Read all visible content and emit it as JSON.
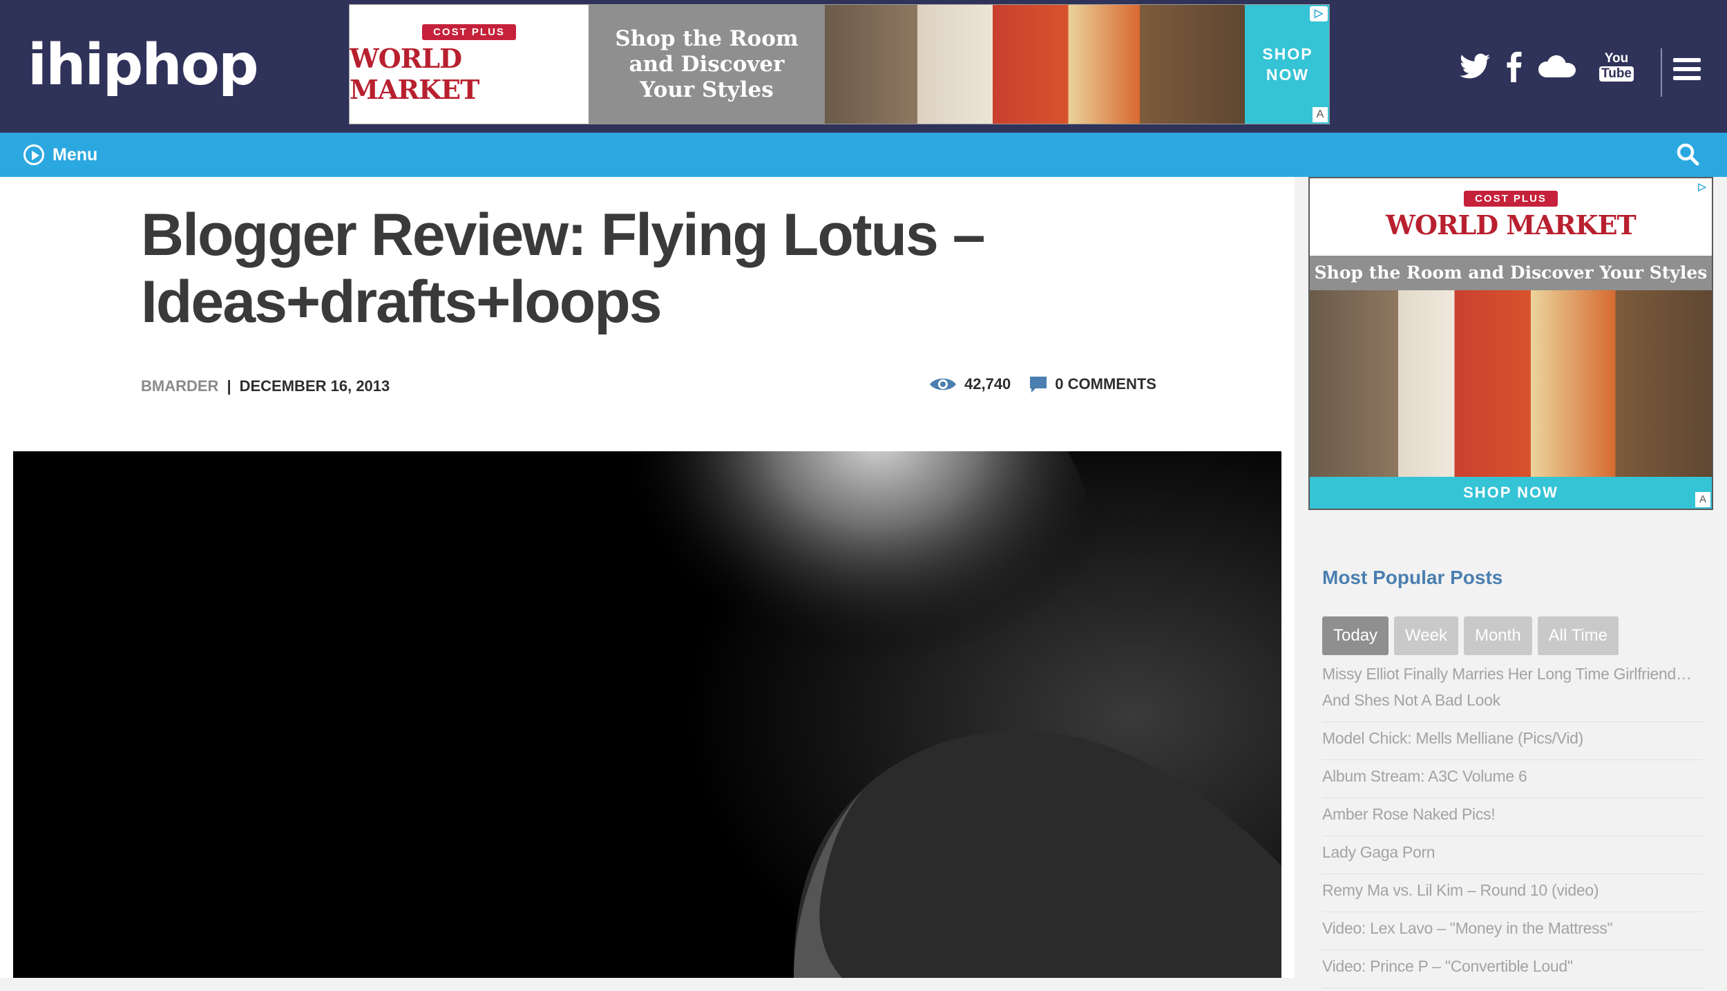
{
  "header": {
    "logo": "ihiphop",
    "menu_label": "Menu"
  },
  "ad_top": {
    "ribbon": "COST PLUS",
    "brand": "WORLD MARKET",
    "headline_line1": "Shop the Room",
    "headline_line2": "and Discover",
    "headline_line3": "Your Styles",
    "cta_line1": "SHOP",
    "cta_line2": "NOW"
  },
  "article": {
    "title": "Blogger Review: Flying Lotus – Ideas+drafts+loops",
    "author": "BMARDER",
    "separator": "|",
    "date": "DECEMBER 16, 2013",
    "views": "42,740",
    "comments": "0 COMMENTS"
  },
  "ad_side": {
    "ribbon": "COST PLUS",
    "brand": "WORLD MARKET",
    "headline": "Shop the Room and Discover Your Styles",
    "cta": "SHOP NOW"
  },
  "popular": {
    "title": "Most Popular Posts",
    "tabs": [
      "Today",
      "Week",
      "Month",
      "All Time"
    ],
    "active_tab": "Today",
    "posts": [
      "Missy Elliot Finally Marries Her Long Time Girlfriend…And Shes Not A Bad Look",
      "Model Chick: Mells Melliane (Pics/Vid)",
      "Album Stream: A3C Volume 6",
      "Amber Rose Naked Pics!",
      "Lady Gaga Porn",
      "Remy Ma vs. Lil Kim – Round 10 (video)",
      "Video: Lex Lavo – \"Money in the Mattress\"",
      "Video: Prince P – \"Convertible Loud\""
    ]
  },
  "colors": {
    "header_bg": "#2f3259",
    "nav_bg": "#2ca8e0",
    "accent_link": "#4a7fb0",
    "ad_cta": "#35c3d6",
    "brand_red": "#b8202f"
  },
  "icons": [
    "twitter-icon",
    "facebook-icon",
    "soundcloud-icon",
    "youtube-icon",
    "hamburger-icon",
    "play-icon",
    "search-icon",
    "eye-icon",
    "comment-icon",
    "adchoices-icon"
  ]
}
